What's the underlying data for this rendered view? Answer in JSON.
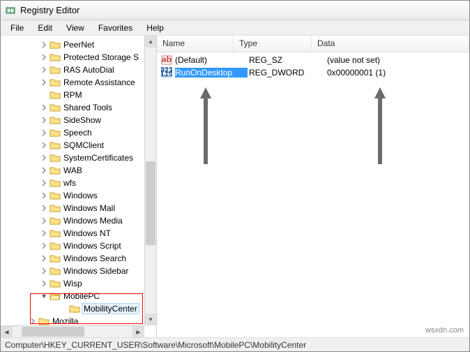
{
  "titlebar": {
    "title": "Registry Editor"
  },
  "menubar": {
    "file": "File",
    "edit": "Edit",
    "view": "View",
    "favorites": "Favorites",
    "help": "Help"
  },
  "tree": {
    "items": [
      {
        "label": "PeerNet",
        "depth": 0,
        "exp": "col"
      },
      {
        "label": "Protected Storage S",
        "depth": 0,
        "exp": "col"
      },
      {
        "label": "RAS AutoDial",
        "depth": 0,
        "exp": "col"
      },
      {
        "label": "Remote Assistance",
        "depth": 0,
        "exp": "col"
      },
      {
        "label": "RPM",
        "depth": 0,
        "exp": "none"
      },
      {
        "label": "Shared Tools",
        "depth": 0,
        "exp": "col"
      },
      {
        "label": "SideShow",
        "depth": 0,
        "exp": "col"
      },
      {
        "label": "Speech",
        "depth": 0,
        "exp": "col"
      },
      {
        "label": "SQMClient",
        "depth": 0,
        "exp": "col"
      },
      {
        "label": "SystemCertificates",
        "depth": 0,
        "exp": "col"
      },
      {
        "label": "WAB",
        "depth": 0,
        "exp": "col"
      },
      {
        "label": "wfs",
        "depth": 0,
        "exp": "col"
      },
      {
        "label": "Windows",
        "depth": 0,
        "exp": "col"
      },
      {
        "label": "Windows Mail",
        "depth": 0,
        "exp": "col"
      },
      {
        "label": "Windows Media",
        "depth": 0,
        "exp": "col"
      },
      {
        "label": "Windows NT",
        "depth": 0,
        "exp": "col"
      },
      {
        "label": "Windows Script",
        "depth": 0,
        "exp": "col"
      },
      {
        "label": "Windows Search",
        "depth": 0,
        "exp": "col"
      },
      {
        "label": "Windows Sidebar",
        "depth": 0,
        "exp": "col"
      },
      {
        "label": "Wisp",
        "depth": 0,
        "exp": "col"
      },
      {
        "label": "MobilePC",
        "depth": 0,
        "exp": "exp"
      },
      {
        "label": "MobilityCenter",
        "depth": 2,
        "exp": "none",
        "selected": true
      },
      {
        "label": "Mozilla",
        "depth": 1,
        "exp": "col"
      }
    ]
  },
  "list": {
    "columns": {
      "name": "Name",
      "type": "Type",
      "data": "Data"
    },
    "rows": [
      {
        "icon": "str",
        "name": "(Default)",
        "type": "REG_SZ",
        "data": "(value not set)",
        "selected": false
      },
      {
        "icon": "num",
        "name": "RunOnDesktop",
        "type": "REG_DWORD",
        "data": "0x00000001 (1)",
        "selected": true
      }
    ]
  },
  "statusbar": {
    "path": "Computer\\HKEY_CURRENT_USER\\Software\\Microsoft\\MobilePC\\MobilityCenter"
  },
  "watermark": "wsxdn.com"
}
